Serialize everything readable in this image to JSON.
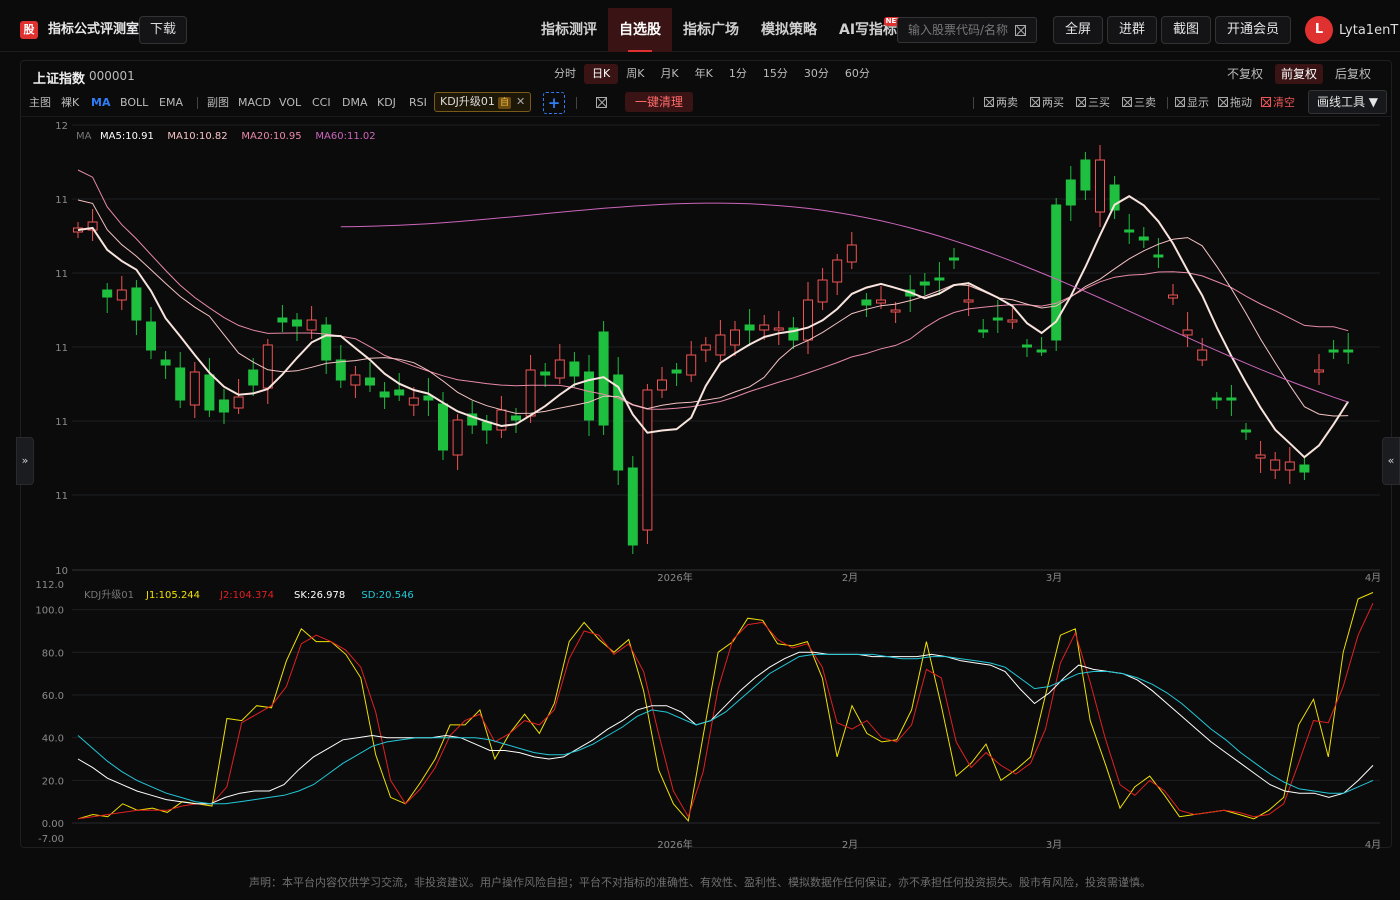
{
  "header": {
    "logo_char": "股",
    "brand": "指标公式评测室",
    "download": "下载",
    "nav": [
      {
        "label": "指标测评",
        "active": false
      },
      {
        "label": "自选股",
        "active": true
      },
      {
        "label": "指标广场",
        "active": false
      },
      {
        "label": "模拟策略",
        "active": false
      },
      {
        "label": "AI写指标",
        "active": false,
        "badge": "NEW"
      }
    ],
    "search_placeholder": "输入股票代码/名称",
    "buttons": [
      "全屏",
      "进群",
      "截图",
      "开通会员"
    ],
    "avatar_letter": "L",
    "username": "Lyta1enT"
  },
  "stock": {
    "name": "上证指数",
    "code": "000001"
  },
  "periods": [
    "分时",
    "日K",
    "周K",
    "月K",
    "年K",
    "1分",
    "15分",
    "30分",
    "60分"
  ],
  "active_period": "日K",
  "adjust": [
    "不复权",
    "前复权",
    "后复权"
  ],
  "active_adjust": "前复权",
  "toolbar": {
    "main_label": "主图",
    "main_items": [
      "裸K",
      "MA",
      "BOLL",
      "EMA"
    ],
    "active_main": "MA",
    "sub_label": "副图",
    "sub_items": [
      "MACD",
      "VOL",
      "CCI",
      "DMA",
      "KDJ",
      "RSI"
    ],
    "custom_indicator": "KDJ升级01",
    "custom_badge": "自",
    "add": "+",
    "one_click_clear": "一键清理",
    "signals": [
      "两卖",
      "两买",
      "三买",
      "三卖",
      "显示",
      "拖动"
    ],
    "clear_draw": "清空",
    "draw_tools": "画线工具 ▼"
  },
  "side": {
    "left": "»",
    "right": "«"
  },
  "chart_data": [
    {
      "type": "candlestick",
      "legend_prefix": "MA",
      "legend": [
        {
          "name": "MA5:10.91",
          "color": "#ffffff"
        },
        {
          "name": "MA10:10.82",
          "color": "#f4c2c2"
        },
        {
          "name": "MA20:10.95",
          "color": "#e88aa6"
        },
        {
          "name": "MA60:11.02",
          "color": "#cc66bb"
        }
      ],
      "y_ticks": [
        "12",
        "11",
        "11",
        "11",
        "11",
        "11",
        "10"
      ],
      "x_ticks": [
        "2026年",
        "2月",
        "3月",
        "4月"
      ],
      "colors": {
        "up": "#f05454",
        "down": "#1fbf3f",
        "ma5": "#f8e4dc",
        "ma10": "#f4c2c2",
        "ma20": "#e88aa6",
        "ma60": "#cc66bb"
      }
    },
    {
      "type": "line",
      "title": "KDJ升级01",
      "legend": [
        {
          "name": "J1:105.244",
          "color": "#f0e000"
        },
        {
          "name": "J2:104.374",
          "color": "#e02020"
        },
        {
          "name": "SK:26.978",
          "color": "#ffffff"
        },
        {
          "name": "SD:20.546",
          "color": "#22c8d8"
        }
      ],
      "y_ticks": [
        "112.0",
        "100.0",
        "80.0",
        "60.0",
        "40.0",
        "20.0",
        "0.00",
        "-7.00"
      ],
      "x_ticks": [
        "2026年",
        "2月",
        "3月",
        "4月"
      ],
      "ylim": [
        -7,
        112
      ],
      "series": [
        {
          "name": "J1",
          "color": "#f0e000",
          "values": [
            2,
            4,
            3,
            9,
            6,
            7,
            5,
            10,
            9,
            8,
            49,
            48,
            55,
            54,
            76,
            91,
            85,
            85,
            79,
            68,
            32,
            12,
            9,
            19,
            30,
            46,
            46,
            53,
            30,
            42,
            51,
            42,
            56,
            85,
            94,
            86,
            80,
            86,
            62,
            25,
            9,
            1,
            41,
            80,
            85,
            96,
            95,
            84,
            83,
            85,
            68,
            31,
            55,
            42,
            38,
            39,
            53,
            85,
            55,
            22,
            28,
            37,
            20,
            25,
            31,
            60,
            88,
            91,
            48,
            28,
            7,
            17,
            22,
            13,
            3,
            4,
            5,
            6,
            4,
            2,
            6,
            12,
            46,
            58,
            31,
            80,
            105,
            108
          ]
        },
        {
          "name": "J2",
          "color": "#e02020",
          "values": [
            2,
            3,
            4,
            5,
            6,
            6,
            6,
            8,
            9,
            9,
            17,
            47,
            51,
            55,
            64,
            84,
            88,
            85,
            81,
            73,
            52,
            20,
            9,
            16,
            26,
            41,
            48,
            51,
            38,
            42,
            48,
            46,
            53,
            77,
            90,
            88,
            79,
            84,
            71,
            42,
            15,
            3,
            24,
            63,
            86,
            93,
            94,
            86,
            82,
            84,
            73,
            47,
            44,
            48,
            40,
            38,
            46,
            72,
            68,
            38,
            26,
            33,
            27,
            23,
            28,
            44,
            75,
            89,
            66,
            40,
            18,
            13,
            20,
            15,
            6,
            4,
            5,
            6,
            5,
            3,
            4,
            9,
            28,
            48,
            47,
            64,
            88,
            103
          ]
        },
        {
          "name": "SK",
          "color": "#ffffff",
          "values": [
            30,
            26,
            21,
            18,
            15,
            13,
            11,
            10,
            9,
            9,
            12,
            14,
            15,
            15,
            18,
            25,
            31,
            35,
            39,
            40,
            41,
            40,
            40,
            40,
            40,
            41,
            40,
            37,
            34,
            34,
            33,
            31,
            30,
            31,
            35,
            39,
            44,
            48,
            53,
            55,
            55,
            52,
            46,
            48,
            55,
            62,
            68,
            73,
            77,
            80,
            80,
            79,
            79,
            79,
            78,
            78,
            78,
            78,
            79,
            78,
            76,
            75,
            74,
            71,
            63,
            56,
            61,
            68,
            74,
            72,
            71,
            70,
            67,
            62,
            56,
            50,
            44,
            38,
            33,
            28,
            23,
            18,
            15,
            14,
            14,
            12,
            14,
            20,
            27
          ]
        },
        {
          "name": "SD",
          "color": "#22c8d8",
          "values": [
            41,
            35,
            29,
            24,
            20,
            17,
            14,
            12,
            10,
            9,
            9,
            10,
            11,
            12,
            13,
            15,
            18,
            23,
            28,
            32,
            36,
            38,
            39,
            40,
            40,
            40,
            40,
            40,
            39,
            37,
            35,
            33,
            32,
            32,
            34,
            37,
            41,
            45,
            50,
            53,
            52,
            49,
            46,
            48,
            52,
            58,
            64,
            70,
            74,
            78,
            79,
            79,
            79,
            79,
            79,
            78,
            77,
            77,
            78,
            78,
            77,
            76,
            75,
            73,
            68,
            63,
            64,
            67,
            70,
            71,
            71,
            70,
            68,
            65,
            61,
            56,
            50,
            44,
            39,
            33,
            28,
            23,
            19,
            16,
            15,
            14,
            14,
            17,
            20
          ]
        }
      ]
    }
  ],
  "disclaimer": "声明：本平台内容仅供学习交流，非投资建议。用户操作风险自担；平台不对指标的准确性、有效性、盈利性、模拟数据作任何保证，亦不承担任何投资损失。股市有风险，投资需谨慎。"
}
